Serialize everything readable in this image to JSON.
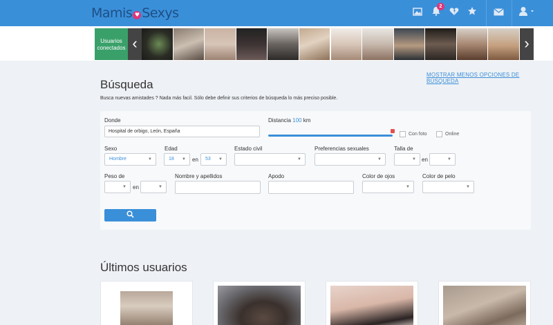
{
  "header": {
    "logo_left": "Mamis",
    "logo_heart": "♥",
    "logo_right": "Sexys",
    "icons": [
      "photo-icon",
      "bell-icon",
      "broken-heart-icon",
      "star-icon",
      "mail-icon",
      "user-icon"
    ],
    "notifications_count": "2"
  },
  "strip": {
    "online_label": "Usuarios conectados",
    "prev_arrow": "‹",
    "next_arrow": "›",
    "thumbnails": 12
  },
  "search": {
    "toggle_link": "MOSTRAR MENOS OPCIONES DE BÚSQUEDA",
    "title": "Búsqueda",
    "subtitle": "Busca nuevas amistades ? Nada más facil. Sólo debe definir sus criterios de búsqueda lo más preciso posible.",
    "donde_label": "Donde",
    "donde_value": "Hospital de orbigo, León, España",
    "distancia_label": "Distancia",
    "distancia_value": "100",
    "distancia_unit": "km",
    "distancia_fill_fraction": 1.0,
    "con_foto_label": "Con foto",
    "online_label": "Online",
    "sexo_label": "Sexo",
    "sexo_value": "Hombre",
    "edad_label": "Edad",
    "edad_min": "18",
    "edad_max": "53",
    "en_label": "en",
    "estado_civil_label": "Estado civil",
    "preferencias_label": "Preferencias sexuales",
    "talla_label": "Talla de",
    "peso_label": "Peso de",
    "nombre_label": "Nombre y apellidos",
    "apodo_label": "Apodo",
    "color_ojos_label": "Color de ojos",
    "color_pelo_label": "Color de pelo",
    "search_button_icon": "search-icon"
  },
  "latest": {
    "title": "Últimos usuarios"
  },
  "colors": {
    "primary": "#3a8fd9",
    "online_box": "#3aa06a",
    "badge": "#e0357a"
  }
}
